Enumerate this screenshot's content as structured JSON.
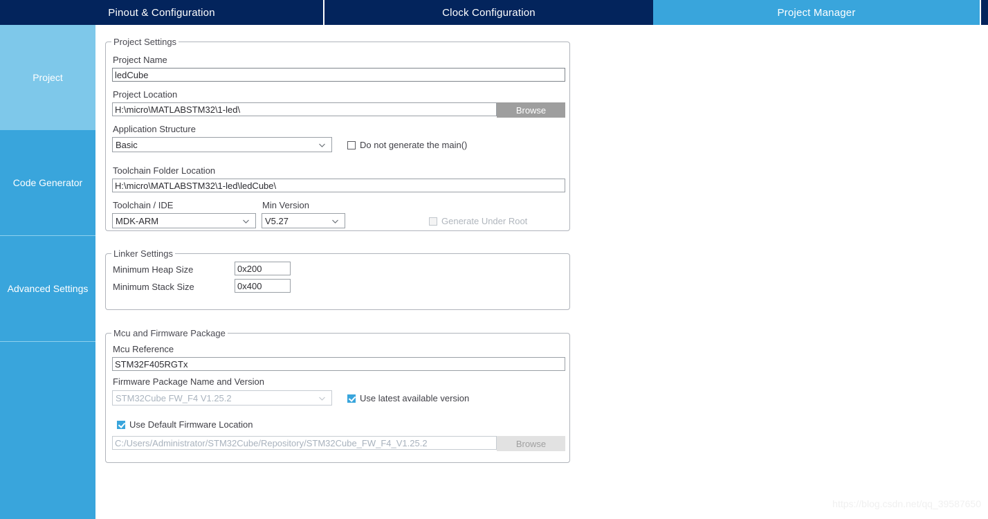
{
  "tabs": [
    {
      "label": "Pinout & Configuration",
      "active": false
    },
    {
      "label": "Clock Configuration",
      "active": false
    },
    {
      "label": "Project Manager",
      "active": true
    }
  ],
  "sidebar": {
    "items": [
      {
        "label": "Project",
        "selected": true
      },
      {
        "label": "Code Generator",
        "selected": false
      },
      {
        "label": "Advanced Settings",
        "selected": false
      }
    ]
  },
  "project_settings": {
    "title": "Project Settings",
    "project_name_label": "Project Name",
    "project_name_value": "ledCube",
    "project_location_label": "Project Location",
    "project_location_value": "H:\\micro\\MATLABSTM32\\1-led\\",
    "project_location_browse": "Browse",
    "application_structure_label": "Application Structure",
    "application_structure_value": "Basic",
    "do_not_generate_main_label": "Do not generate the main()",
    "do_not_generate_main_checked": false,
    "toolchain_folder_label": "Toolchain Folder Location",
    "toolchain_folder_value": "H:\\micro\\MATLABSTM32\\1-led\\ledCube\\",
    "toolchain_ide_label": "Toolchain / IDE",
    "toolchain_ide_value": "MDK-ARM",
    "min_version_label": "Min Version",
    "min_version_value": "V5.27",
    "generate_under_root_label": "Generate Under Root",
    "generate_under_root_checked": false,
    "generate_under_root_disabled": true
  },
  "linker_settings": {
    "title": "Linker Settings",
    "min_heap_label": "Minimum Heap Size",
    "min_heap_value": "0x200",
    "min_stack_label": "Minimum Stack Size",
    "min_stack_value": "0x400"
  },
  "mcu_firmware": {
    "title": "Mcu and Firmware Package",
    "mcu_reference_label": "Mcu Reference",
    "mcu_reference_value": "STM32F405RGTx",
    "firmware_package_label": "Firmware Package Name and Version",
    "firmware_package_value": "STM32Cube FW_F4 V1.25.2",
    "use_latest_label": "Use latest available version",
    "use_latest_checked": true,
    "use_default_location_label": "Use Default Firmware Location",
    "use_default_location_checked": true,
    "firmware_location_value": "C:/Users/Administrator/STM32Cube/Repository/STM32Cube_FW_F4_V1.25.2",
    "firmware_browse": "Browse"
  },
  "watermark": "https://blog.csdn.net/qq_39587650",
  "colors": {
    "tab_navy": "#03245c",
    "accent_blue": "#39a5dc",
    "sidebar_selected": "#7ec8ea",
    "button_gray": "#9e9e9e"
  }
}
